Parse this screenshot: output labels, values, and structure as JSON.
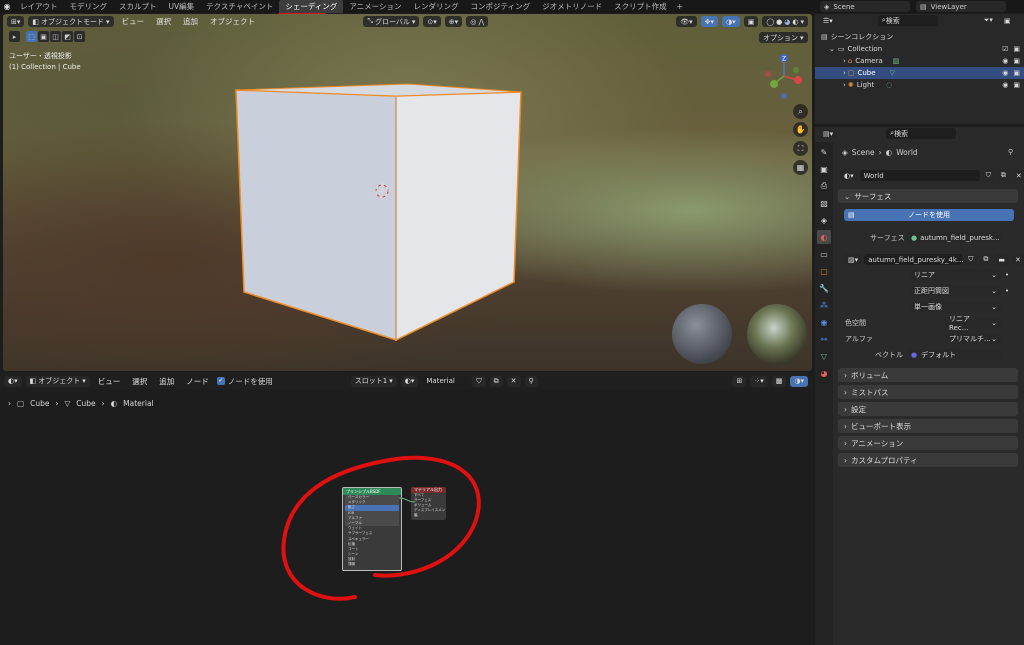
{
  "workspace_tabs": [
    "レイアウト",
    "モデリング",
    "スカルプト",
    "UV編集",
    "テクスチャペイント",
    "シェーディング",
    "アニメーション",
    "レンダリング",
    "コンポジティング",
    "ジオメトリノード",
    "スクリプト作成"
  ],
  "active_workspace": "シェーディング",
  "add_tab_label": "+",
  "scene_name": "Scene",
  "view_layer_name": "ViewLayer",
  "viewport": {
    "mode": "オブジェクトモード",
    "menus": [
      "ビュー",
      "選択",
      "追加",
      "オブジェクト"
    ],
    "transform_orientation": "グローバル",
    "options_label": "オプション",
    "info_line1": "ユーザー・透視投影",
    "info_line2": "(1) Collection | Cube",
    "gizmo_z": "Z"
  },
  "node_editor": {
    "mode": "オブジェクト",
    "menus": [
      "ビュー",
      "選択",
      "追加",
      "ノード"
    ],
    "use_nodes_label": "ノードを使用",
    "slot": "スロット1",
    "material_name": "Material",
    "breadcrumb": [
      "Cube",
      "Cube",
      "Material"
    ],
    "node1_title": "プリンシプルBSDF",
    "node1_rows": [
      "ベースカラー",
      "メタリック",
      "粗さ",
      "IOR",
      "アルファ",
      "ノーマル",
      "ウェイト",
      "サブサーフェス",
      "スペキュラー",
      "伝播",
      "コート",
      "シーン",
      "放射",
      "薄膜"
    ],
    "node2_title": "マテリアル出力",
    "node2_rows": [
      "すべて",
      "サーフェス",
      "ボリューム",
      "ディスプレイスメント",
      "幅"
    ]
  },
  "outliner": {
    "search_placeholder": "検索",
    "scene_collection": "シーンコレクション",
    "collection": "Collection",
    "items": [
      "Camera",
      "Cube",
      "Light"
    ]
  },
  "properties": {
    "search_placeholder": "検索",
    "breadcrumb_scene": "Scene",
    "breadcrumb_world": "World",
    "world_name": "World",
    "surface_panel": "サーフェス",
    "use_nodes_button": "ノードを使用",
    "surface_label": "サーフェス",
    "surface_value": "autumn_field_puresk...",
    "image_name": "autumn_field_puresky_4k...",
    "interpolation": "リニア",
    "projection": "正距円筒図",
    "source": "単一画像",
    "color_space_label": "色空間",
    "color_space": "リニア Rec...",
    "alpha_label": "アルファ",
    "alpha": "プリマルチ...",
    "vector_label": "ベクトル",
    "vector": "デフォルト",
    "panels": [
      "ボリューム",
      "ミストパス",
      "設定",
      "ビューポート表示",
      "アニメーション",
      "カスタムプロパティ"
    ]
  },
  "colors": {
    "accent": "#4772b3",
    "selection_outline": "#f08a24",
    "annotation": "#e01010",
    "shader_header": "#2f8a5a",
    "output_header": "#7a2b2b"
  }
}
